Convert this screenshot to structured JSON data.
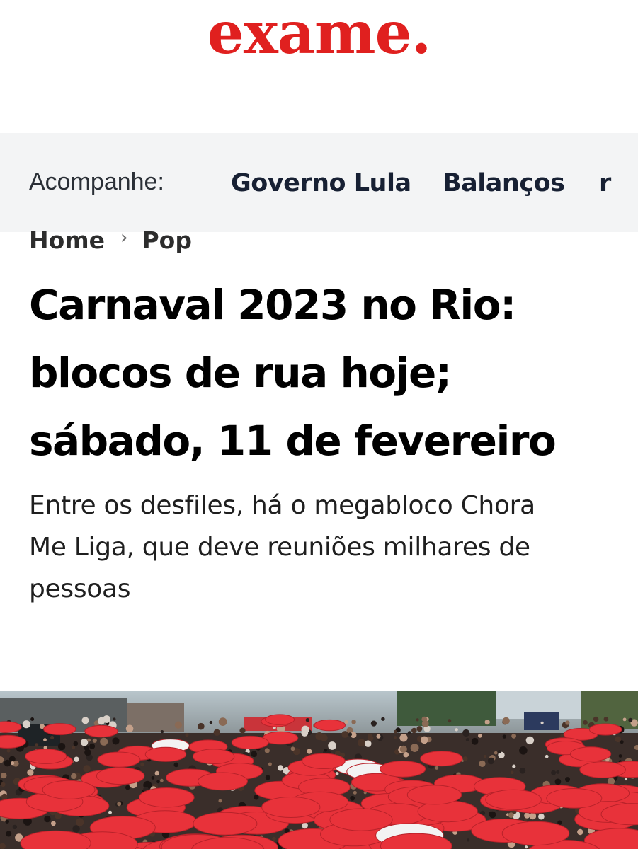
{
  "brand": {
    "logo_text": "exame.",
    "accent_color": "#e0201f"
  },
  "nav": {
    "label": "Acompanhe:",
    "links": [
      "Governo Lula",
      "Balanços",
      "r"
    ]
  },
  "breadcrumb": {
    "home": "Home",
    "separator": "›",
    "section": "Pop"
  },
  "article": {
    "title_lines": [
      "Carnaval 2023 no Rio:",
      "blocos de rua hoje;",
      "sábado, 11 de fevereiro"
    ],
    "subtitle_lines": [
      "Entre os desfiles, há o megabloco Chora",
      "Me Liga, que deve reuniões milhares de",
      "pessoas"
    ]
  },
  "hero_image": {
    "subject": "crowd-with-red-umbrellas",
    "umbrella_color": "#e8323a"
  }
}
